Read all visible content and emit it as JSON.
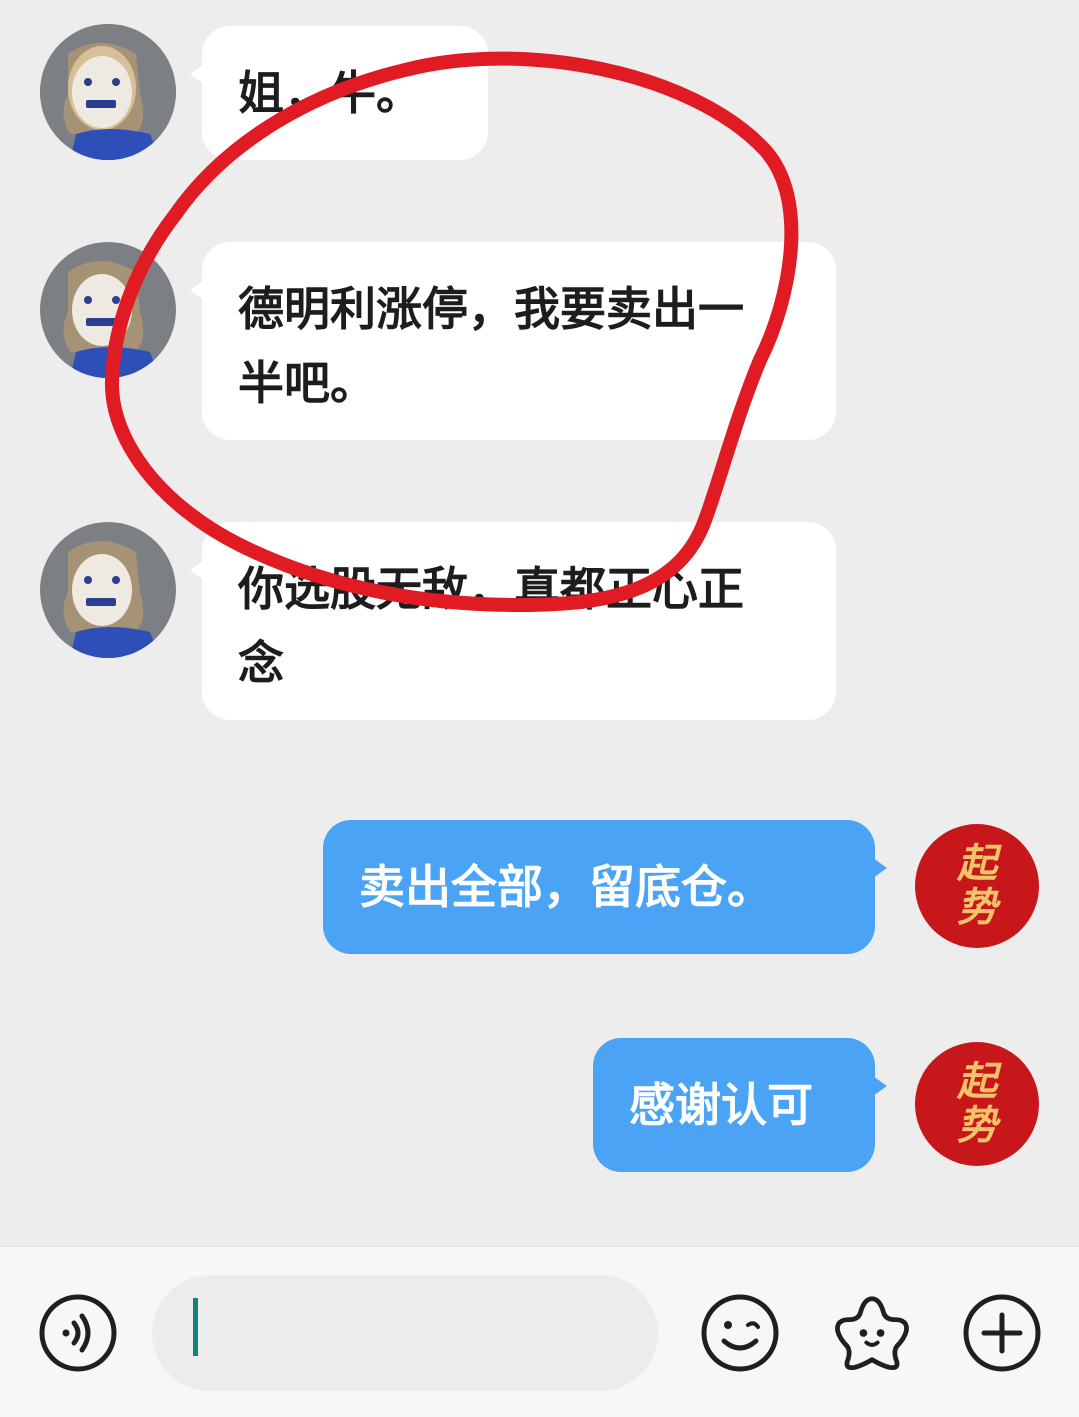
{
  "messages": [
    {
      "side": "in",
      "text": "姐，牛。"
    },
    {
      "side": "in",
      "text": "德明利涨停，我要卖出一半吧。"
    },
    {
      "side": "in",
      "text": "你选股无敌，真都正心正念"
    },
    {
      "side": "out",
      "text": "卖出全部，留底仓。"
    },
    {
      "side": "out",
      "text": "感谢认可"
    }
  ],
  "self_avatar": {
    "line1": "起",
    "line2": "势"
  },
  "input_bar": {
    "voice_icon": "voice-icon",
    "emoji_icon": "emoji-icon",
    "sticker_icon": "sticker-icon",
    "more_icon": "plus-icon"
  },
  "colors": {
    "background": "#ededed",
    "bubble_in": "#ffffff",
    "bubble_out": "#4aa3f5",
    "annotation": "#e01b24"
  }
}
